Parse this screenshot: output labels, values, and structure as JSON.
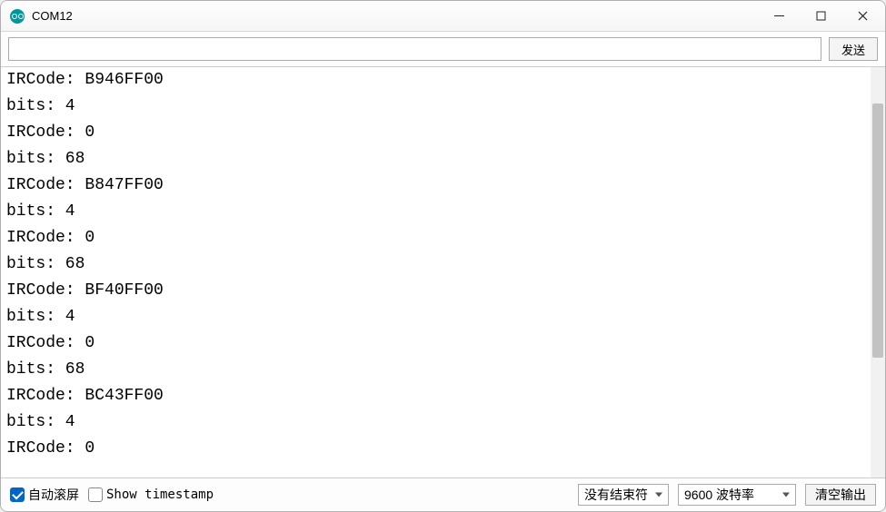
{
  "window": {
    "title": "COM12"
  },
  "toolbar": {
    "input_value": "",
    "send_label": "发送"
  },
  "console": {
    "lines": [
      "IRCode: B946FF00",
      "bits: 4",
      "IRCode: 0",
      "bits: 68",
      "IRCode: B847FF00",
      "bits: 4",
      "IRCode: 0",
      "bits: 68",
      "IRCode: BF40FF00",
      "bits: 4",
      "IRCode: 0",
      "bits: 68",
      "IRCode: BC43FF00",
      "bits: 4",
      "IRCode: 0"
    ]
  },
  "statusbar": {
    "autoscroll_label": "自动滚屏",
    "autoscroll_checked": true,
    "timestamp_label": "Show timestamp",
    "timestamp_checked": false,
    "lineending_selected": "没有结束符",
    "baud_selected": "9600 波特率",
    "clear_label": "清空输出"
  }
}
